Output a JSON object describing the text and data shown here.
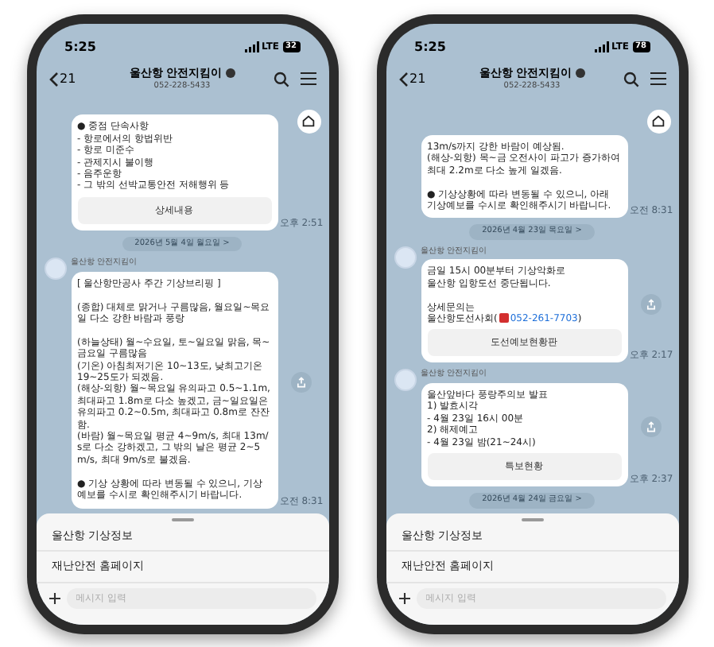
{
  "phones": [
    {
      "status": {
        "time": "5:25",
        "network": "LTE",
        "battery": "32"
      },
      "header": {
        "back_count": "21",
        "title": "울산항 안전지킴이",
        "phone": "052-228-5433"
      },
      "messages": [
        {
          "kind": "bubble",
          "text": "● 중점 단속사항\n- 항로에서의 항법위반\n- 항로 미준수\n- 관제지시 불이행\n- 음주운항\n- 그 밖의 선박교통안전 저해행위 등",
          "button": "상세내용",
          "time": "오후 2:51",
          "share": false
        },
        {
          "kind": "date",
          "text": "2026년 5월 4일 월요일 >"
        },
        {
          "kind": "bubble",
          "sender": "울산항 안전지킴이",
          "text": "[ 울산항만공사 주간 기상브리핑 ]\n\n(종합) 대체로 맑거나 구름많음, 월요일~목요일 다소 강한 바람과 풍랑\n\n(하늘상태) 월~수요일, 토~일요일 맑음, 목~금요일 구름많음\n(기온) 아침최저기온 10~13도, 낮최고기온 19~25도가 되겠음.\n(해상-외항) 월~목요일 유의파고 0.5~1.1m, 최대파고 1.8m로 다소 높겠고, 금~일요일은 유의파고 0.2~0.5m, 최대파고 0.8m로 잔잔함.\n(바람) 월~목요일 평균 4~9m/s, 최대 13m/s로 다소 강하겠고, 그 밖의 날은 평균 2~5m/s, 최대 9m/s로 불겠음.\n\n● 기상 상황에 따라 변동될 수 있으니, 기상예보를 수시로 확인해주시기 바랍니다.",
          "time": "오전 8:31",
          "share": true
        }
      ],
      "menu": [
        "울산항 기상정보",
        "재난안전 홈페이지"
      ],
      "input": {
        "placeholder": "메시지 입력"
      }
    },
    {
      "status": {
        "time": "5:25",
        "network": "LTE",
        "battery": "78"
      },
      "header": {
        "back_count": "21",
        "title": "울산항 안전지킴이",
        "phone": "052-228-5433"
      },
      "messages": [
        {
          "kind": "bubble",
          "text": "13m/s까지 강한 바람이 예상됨.\n(해상-외항) 목~금 오전사이 파고가 증가하여 최대 2.2m로 다소 높게 일겠음.\n\n● 기상상황에 따라 변동될 수 있으니, 아래 기상예보를 수시로 확인해주시기 바랍니다.",
          "time": "오전 8:31",
          "share": false
        },
        {
          "kind": "date",
          "text": "2026년 4월 23일 목요일 >"
        },
        {
          "kind": "bubble",
          "sender": "울산항 안전지킴이",
          "text": "금일 15시 00분부터 기상악화로\n울산항 입항도선 중단됩니다.\n\n상세문의는\n울산항도선사회(",
          "link": "052-261-7703",
          "suffix": ")",
          "button": "도선예보현황판",
          "time": "오후 2:17",
          "share": true
        },
        {
          "kind": "bubble",
          "sender": "울산항 안전지킴이",
          "text": "울산앞바다 풍랑주의보 발표\n1) 발효시각\n- 4월 23일 16시 00분\n2) 해제예고\n- 4월 23일 밤(21~24시)",
          "button": "특보현황",
          "time": "오후 2:37",
          "share": true
        },
        {
          "kind": "date",
          "text": "2026년 4월 24일 금요일 >"
        }
      ],
      "menu": [
        "울산항 기상정보",
        "재난안전 홈페이지"
      ],
      "input": {
        "placeholder": "메시지 입력"
      }
    }
  ]
}
